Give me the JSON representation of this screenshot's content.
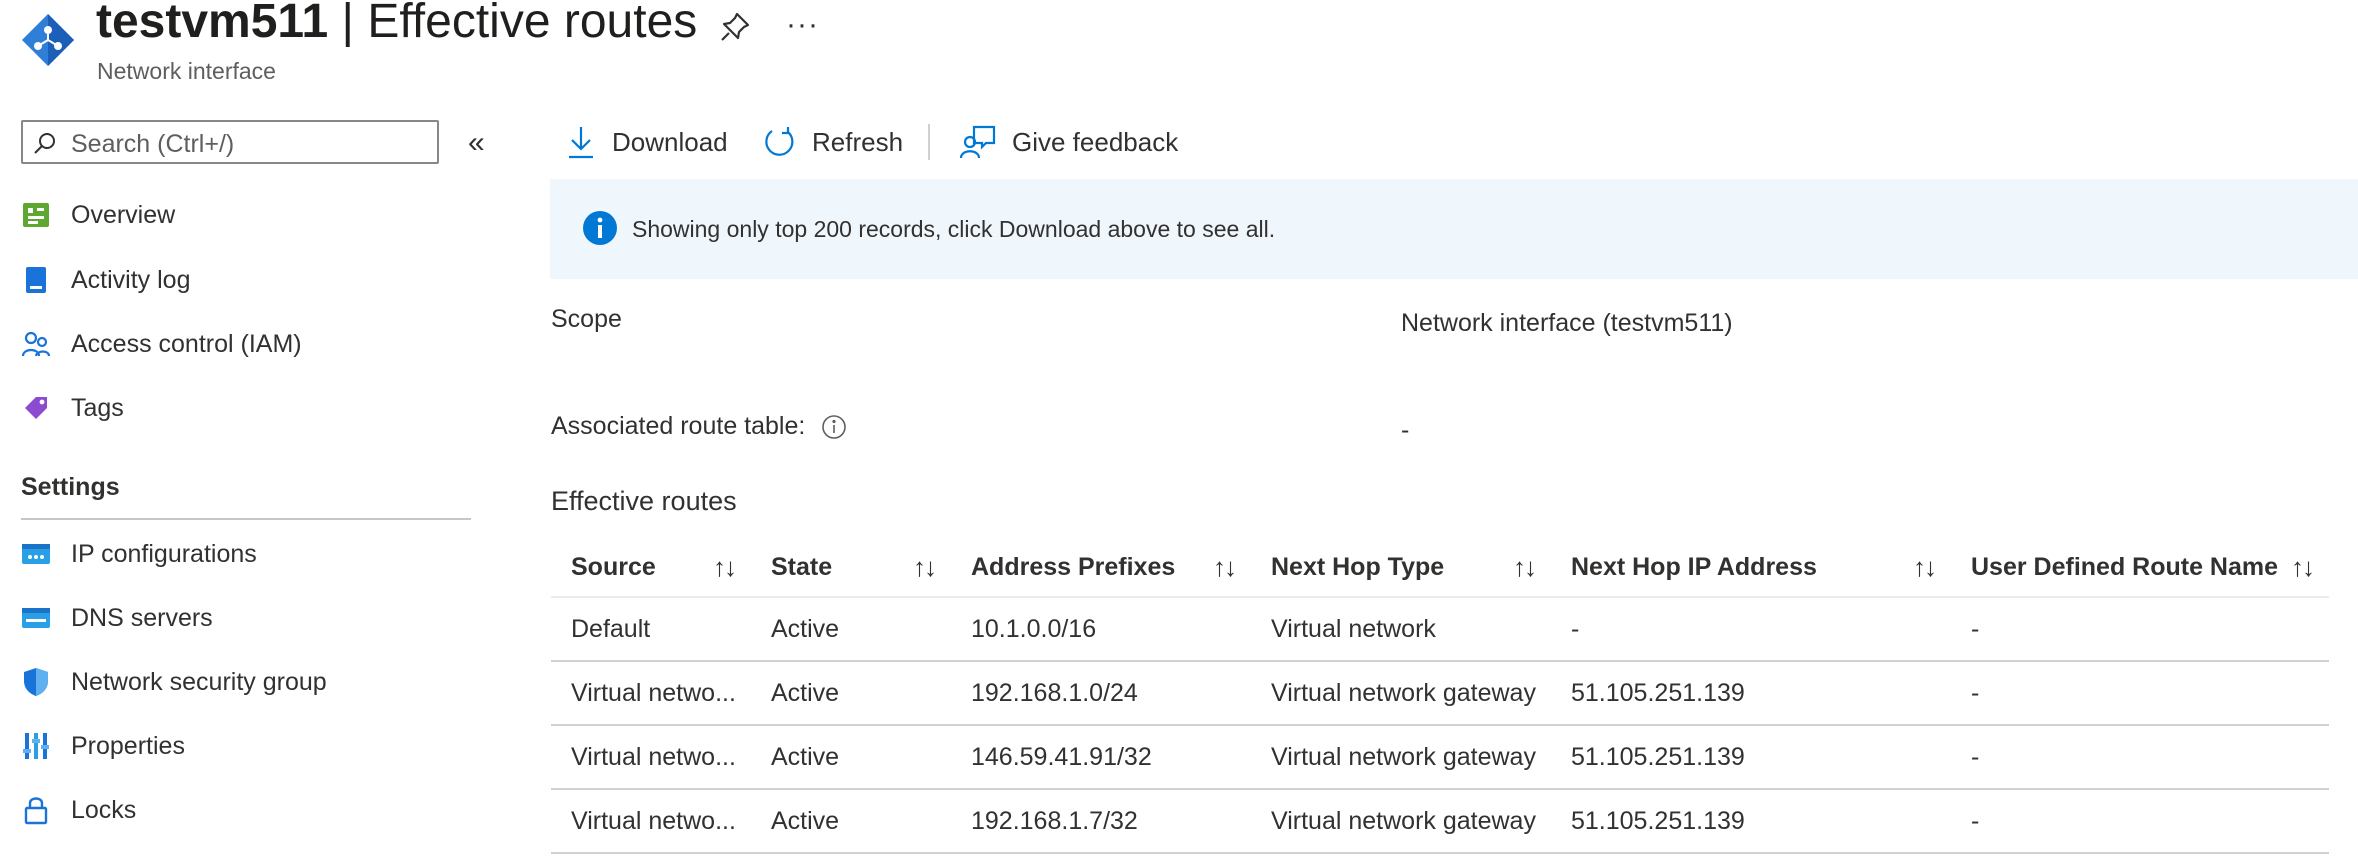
{
  "header": {
    "resource_name": "testvm511",
    "separator": " | ",
    "page_name": "Effective routes",
    "subtitle": "Network interface",
    "more_label": "···"
  },
  "sidebar": {
    "search_placeholder": "Search (Ctrl+/)",
    "collapse_label": "«",
    "items": [
      {
        "label": "Overview",
        "icon": "overview-icon"
      },
      {
        "label": "Activity log",
        "icon": "activity-log-icon"
      },
      {
        "label": "Access control (IAM)",
        "icon": "iam-icon"
      },
      {
        "label": "Tags",
        "icon": "tag-icon"
      }
    ],
    "settings_heading": "Settings",
    "settings_items": [
      {
        "label": "IP configurations",
        "icon": "ip-config-icon"
      },
      {
        "label": "DNS servers",
        "icon": "dns-icon"
      },
      {
        "label": "Network security group",
        "icon": "shield-icon"
      },
      {
        "label": "Properties",
        "icon": "properties-icon"
      },
      {
        "label": "Locks",
        "icon": "lock-icon"
      }
    ]
  },
  "toolbar": {
    "download_label": "Download",
    "refresh_label": "Refresh",
    "feedback_label": "Give feedback"
  },
  "banner": {
    "message": "Showing only top 200 records, click Download above to see all."
  },
  "details": {
    "scope_label": "Scope",
    "scope_value": "Network interface (testvm511)",
    "route_table_label": "Associated route table:",
    "route_table_value": "-"
  },
  "routes": {
    "title": "Effective routes",
    "columns": [
      "Source",
      "State",
      "Address Prefixes",
      "Next Hop Type",
      "Next Hop IP Address",
      "User Defined Route Name"
    ],
    "sort_glyph": "↑↓",
    "rows": [
      [
        "Default",
        "Active",
        "10.1.0.0/16",
        "Virtual network",
        "-",
        "-"
      ],
      [
        "Virtual netwo...",
        "Active",
        "192.168.1.0/24",
        "Virtual network gateway",
        "51.105.251.139",
        "-"
      ],
      [
        "Virtual netwo...",
        "Active",
        "146.59.41.91/32",
        "Virtual network gateway",
        "51.105.251.139",
        "-"
      ],
      [
        "Virtual netwo...",
        "Active",
        "192.168.1.7/32",
        "Virtual network gateway",
        "51.105.251.139",
        "-"
      ]
    ]
  },
  "colors": {
    "accent": "#0078d4",
    "banner_bg": "#eff6fc",
    "text": "#323130"
  }
}
